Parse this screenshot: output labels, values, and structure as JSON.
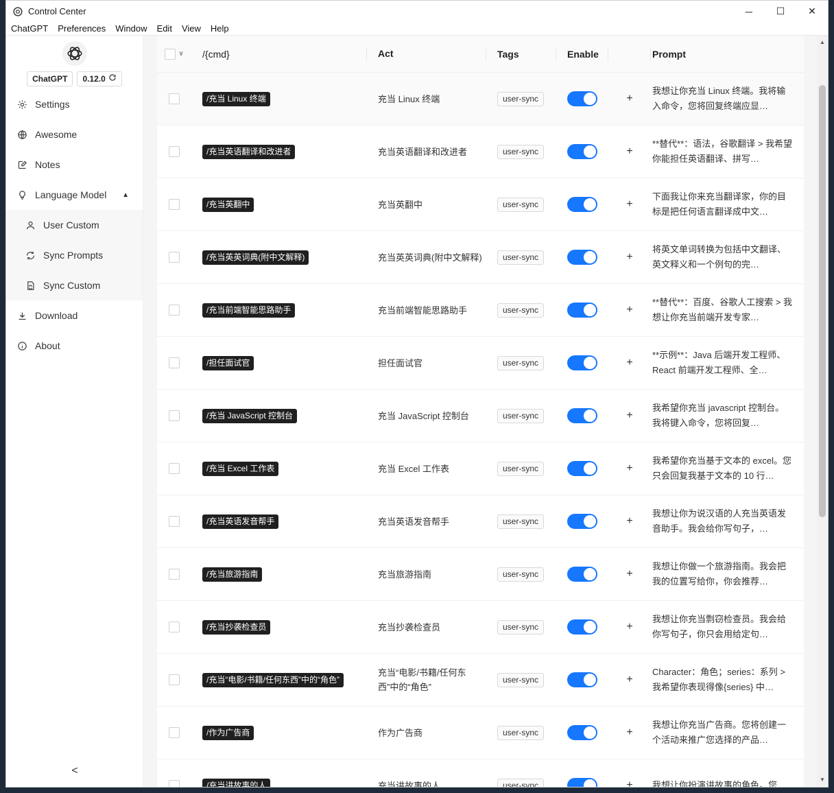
{
  "window": {
    "title": "Control Center",
    "controls": [
      "─",
      "☐",
      "✕"
    ]
  },
  "menubar": [
    "ChatGPT",
    "Preferences",
    "Window",
    "Edit",
    "View",
    "Help"
  ],
  "sidebar": {
    "app_badge": "ChatGPT",
    "version_badge": "0.12.0",
    "items": [
      {
        "label": "Settings",
        "icon": "gear-icon"
      },
      {
        "label": "Awesome",
        "icon": "globe-icon"
      },
      {
        "label": "Notes",
        "icon": "edit-icon"
      },
      {
        "label": "Language Model",
        "icon": "bulb-icon"
      }
    ],
    "subitems": [
      {
        "label": "User Custom",
        "icon": "user-icon"
      },
      {
        "label": "Sync Prompts",
        "icon": "sync-icon"
      },
      {
        "label": "Sync Custom",
        "icon": "file-sync-icon"
      }
    ],
    "bottom_items": [
      {
        "label": "Download",
        "icon": "download-icon"
      },
      {
        "label": "About",
        "icon": "info-icon"
      }
    ],
    "collapse_glyph": "<"
  },
  "table": {
    "columns": {
      "cmd": "/{cmd}",
      "act": "Act",
      "tags": "Tags",
      "enable": "Enable",
      "prompt": "Prompt"
    },
    "rows": [
      {
        "cmd": "/充当 Linux 终端",
        "act": "充当 Linux 终端",
        "tag": "user-sync",
        "enabled": true,
        "prompt": "我想让你充当 Linux 终端。我将输入命令，您将回复终端应显…"
      },
      {
        "cmd": "/充当英语翻译和改进者",
        "act": "充当英语翻译和改进者",
        "tag": "user-sync",
        "enabled": true,
        "prompt": "**替代**：语法，谷歌翻译 > 我希望你能担任英语翻译、拼写…"
      },
      {
        "cmd": "/充当英翻中",
        "act": "充当英翻中",
        "tag": "user-sync",
        "enabled": true,
        "prompt": "下面我让你来充当翻译家，你的目标是把任何语言翻译成中文…"
      },
      {
        "cmd": "/充当英英词典(附中文解释)",
        "act": "充当英英词典(附中文解释)",
        "tag": "user-sync",
        "enabled": true,
        "prompt": "将英文单词转换为包括中文翻译、英文释义和一个例句的完…"
      },
      {
        "cmd": "/充当前端智能思路助手",
        "act": "充当前端智能思路助手",
        "tag": "user-sync",
        "enabled": true,
        "prompt": "**替代**：百度、谷歌人工搜索 > 我想让你充当前端开发专家…"
      },
      {
        "cmd": "/担任面试官",
        "act": "担任面试官",
        "tag": "user-sync",
        "enabled": true,
        "prompt": "**示例**：Java 后端开发工程师、React 前端开发工程师、全…"
      },
      {
        "cmd": "/充当 JavaScript 控制台",
        "act": "充当 JavaScript 控制台",
        "tag": "user-sync",
        "enabled": true,
        "prompt": "我希望你充当 javascript 控制台。我将键入命令，您将回复…"
      },
      {
        "cmd": "/充当 Excel 工作表",
        "act": "充当 Excel 工作表",
        "tag": "user-sync",
        "enabled": true,
        "prompt": "我希望你充当基于文本的 excel。您只会回复我基于文本的 10 行…"
      },
      {
        "cmd": "/充当英语发音帮手",
        "act": "充当英语发音帮手",
        "tag": "user-sync",
        "enabled": true,
        "prompt": "我想让你为说汉语的人充当英语发音助手。我会给你写句子，…"
      },
      {
        "cmd": "/充当旅游指南",
        "act": "充当旅游指南",
        "tag": "user-sync",
        "enabled": true,
        "prompt": "我想让你做一个旅游指南。我会把我的位置写给你，你会推荐…"
      },
      {
        "cmd": "/充当抄袭检查员",
        "act": "充当抄袭检查员",
        "tag": "user-sync",
        "enabled": true,
        "prompt": "我想让你充当剽窃检查员。我会给你写句子，你只会用给定句…"
      },
      {
        "cmd": "/充当“电影/书籍/任何东西”中的“角色”",
        "act": "充当“电影/书籍/任何东西”中的“角色”",
        "tag": "user-sync",
        "enabled": true,
        "prompt": "Character：角色；series：系列 > 我希望你表现得像{series} 中…"
      },
      {
        "cmd": "/作为广告商",
        "act": "作为广告商",
        "tag": "user-sync",
        "enabled": true,
        "prompt": "我想让你充当广告商。您将创建一个活动来推广您选择的产品…"
      },
      {
        "cmd": "/充当讲故事的人",
        "act": "充当讲故事的人",
        "tag": "user-sync",
        "enabled": true,
        "prompt": "我想让你扮演讲故事的角色。您…"
      }
    ],
    "add_glyph": "+"
  },
  "colors": {
    "accent": "#1677ff",
    "tag_dark": "#202020"
  }
}
